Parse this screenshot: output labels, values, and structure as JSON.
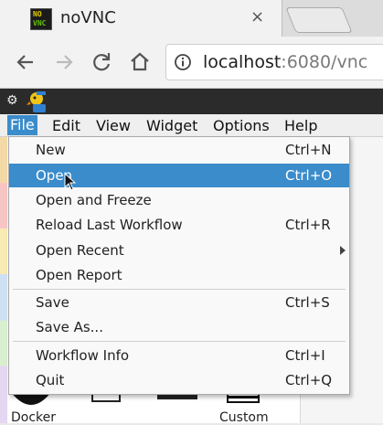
{
  "browser": {
    "tab_title": "noVNC",
    "tab_close": "×",
    "favicon_top": "NO",
    "favicon_bottom": "VNC",
    "url_host": "localhost",
    "url_port": ":6080/vnc"
  },
  "appbar": {
    "gear": "⚙"
  },
  "menubar": {
    "file": "File",
    "edit": "Edit",
    "view": "View",
    "widget": "Widget",
    "options": "Options",
    "help": "Help"
  },
  "file_menu": {
    "items": [
      {
        "label": "New",
        "shortcut": "Ctrl+N"
      },
      {
        "label": "Open",
        "shortcut": "Ctrl+O"
      },
      {
        "label": "Open and Freeze",
        "shortcut": ""
      },
      {
        "label": "Reload Last Workflow",
        "shortcut": "Ctrl+R"
      },
      {
        "label": "Open Recent",
        "shortcut": ""
      },
      {
        "label": "Open Report",
        "shortcut": ""
      },
      {
        "label": "Save",
        "shortcut": "Ctrl+S"
      },
      {
        "label": "Save As...",
        "shortcut": ""
      },
      {
        "label": "Workflow Info",
        "shortcut": "Ctrl+I"
      },
      {
        "label": "Quit",
        "shortcut": "Ctrl+Q"
      }
    ]
  },
  "widgets": {
    "docker_label": "Docker",
    "custom_label": "Custom"
  },
  "colors": {
    "menu_highlight": "#3a8ccb",
    "app_bar": "#2b2b2b"
  }
}
